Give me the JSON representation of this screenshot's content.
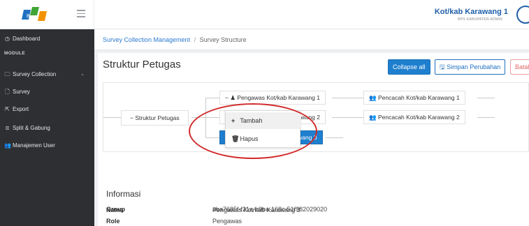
{
  "user": {
    "name": "Kot/kab Karawang 1",
    "role": "BPS KABUPATEN ADMIN"
  },
  "sidebar": {
    "module_label": "MODULE",
    "items": [
      {
        "label": "Dashboard",
        "icon": "dashboard-icon"
      },
      {
        "label": "Survey Collection",
        "icon": "folder-icon"
      },
      {
        "label": "Survey",
        "icon": "file-icon"
      },
      {
        "label": "Export",
        "icon": "export-icon"
      },
      {
        "label": "Split & Gabung",
        "icon": "database-icon"
      },
      {
        "label": "Manajemen User",
        "icon": "users-icon"
      }
    ]
  },
  "breadcrumb": {
    "parent": "Survey Collection Management",
    "separator": "/",
    "current": "Survey Structure"
  },
  "page": {
    "title": "Struktur Petugas"
  },
  "buttons": {
    "collapse": "Collapse all",
    "save": "Simpan Perubahan",
    "cancel": "Batal"
  },
  "tree": {
    "root": "Struktur Petugas",
    "root_prefix": "−",
    "collapse_prefix": "− ♟",
    "group_icon": "👥",
    "supervisors": [
      {
        "label": "Pengawas Kot/kab Karawang 1",
        "enumerator": "Pencacah Kot/kab Karawang 1"
      },
      {
        "label": "Pengawas Kot/kab Karawang 2",
        "enumerator": "Pencacah Kot/kab Karawang 2"
      },
      {
        "label": "Pengawas Kot/kab Karawang 3",
        "selected": true
      }
    ]
  },
  "context_menu": {
    "items": [
      {
        "label": "Tambah",
        "icon": "plus-icon",
        "glyph": "+"
      },
      {
        "label": "Hapus",
        "icon": "trash-icon",
        "glyph": "🗑"
      }
    ]
  },
  "info": {
    "title": "Informasi",
    "rows": [
      {
        "key": "Nama",
        "value": "Pengawas Kot/kab Karawang 3"
      },
      {
        "key": "Role",
        "value": "Pengawas"
      },
      {
        "key": "Group",
        "value": "aba7685f-f21a-b9ba-168c-51f982029020"
      }
    ]
  },
  "colors": {
    "primary": "#1f7fcf",
    "sidebar_bg": "#2d2f33",
    "highlight": "#d22b2b",
    "cancel": "#e06666"
  }
}
